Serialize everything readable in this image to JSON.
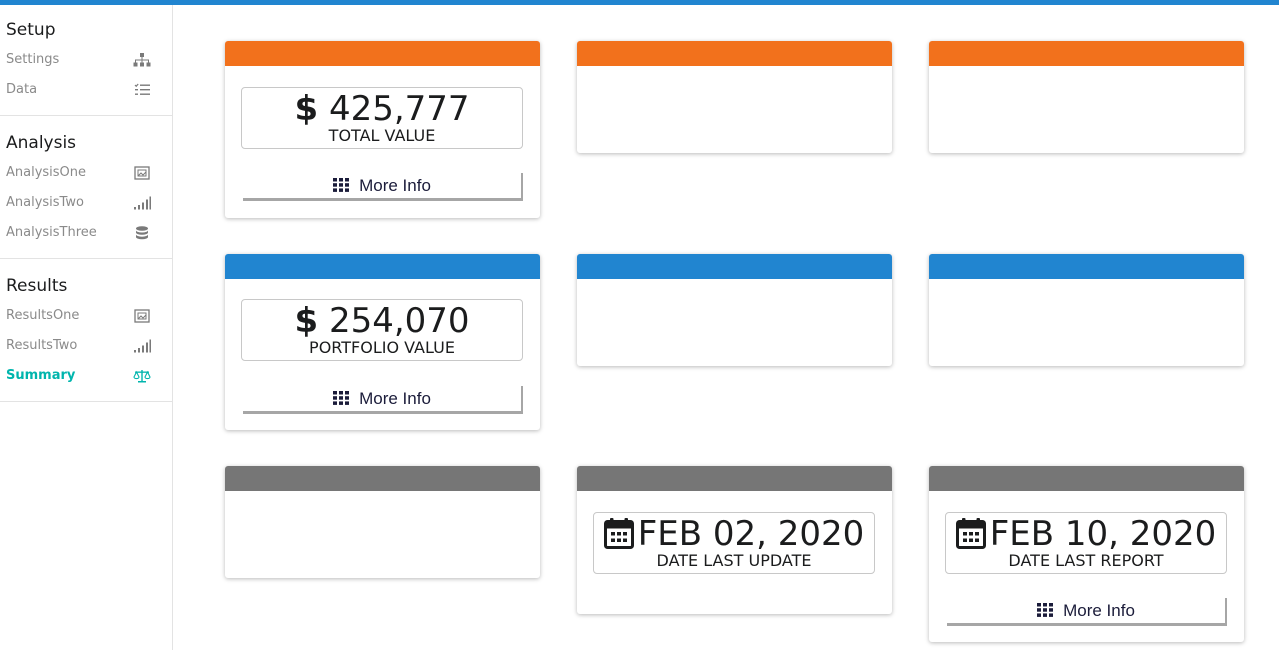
{
  "colors": {
    "topbar": "#2185d0",
    "orange": "#f2711c",
    "blue": "#2185d0",
    "gray": "#767676",
    "active": "#00b5ad"
  },
  "sidebar": {
    "sections": [
      {
        "title": "Setup",
        "items": [
          {
            "label": "Settings",
            "icon": "sitemap-icon"
          },
          {
            "label": "Data",
            "icon": "list-icon"
          }
        ]
      },
      {
        "title": "Analysis",
        "items": [
          {
            "label": "AnalysisOne",
            "icon": "image-frame-icon"
          },
          {
            "label": "AnalysisTwo",
            "icon": "signal-bars-icon"
          },
          {
            "label": "AnalysisThree",
            "icon": "database-icon"
          }
        ]
      },
      {
        "title": "Results",
        "items": [
          {
            "label": "ResultsOne",
            "icon": "image-frame-icon"
          },
          {
            "label": "ResultsTwo",
            "icon": "signal-bars-icon"
          },
          {
            "label": "Summary",
            "icon": "balance-scale-icon",
            "active": true
          }
        ]
      }
    ]
  },
  "cards": {
    "total_value": {
      "prefix": "$",
      "value": "425,777",
      "label": "TOTAL VALUE",
      "button": "More Info"
    },
    "portfolio_value": {
      "prefix": "$",
      "value": "254,070",
      "label": "PORTFOLIO VALUE",
      "button": "More Info"
    },
    "last_update": {
      "value": "FEB 02, 2020",
      "label": "DATE LAST UPDATE"
    },
    "last_report": {
      "value": "FEB 10, 2020",
      "label": "DATE LAST REPORT",
      "button": "More Info"
    }
  }
}
